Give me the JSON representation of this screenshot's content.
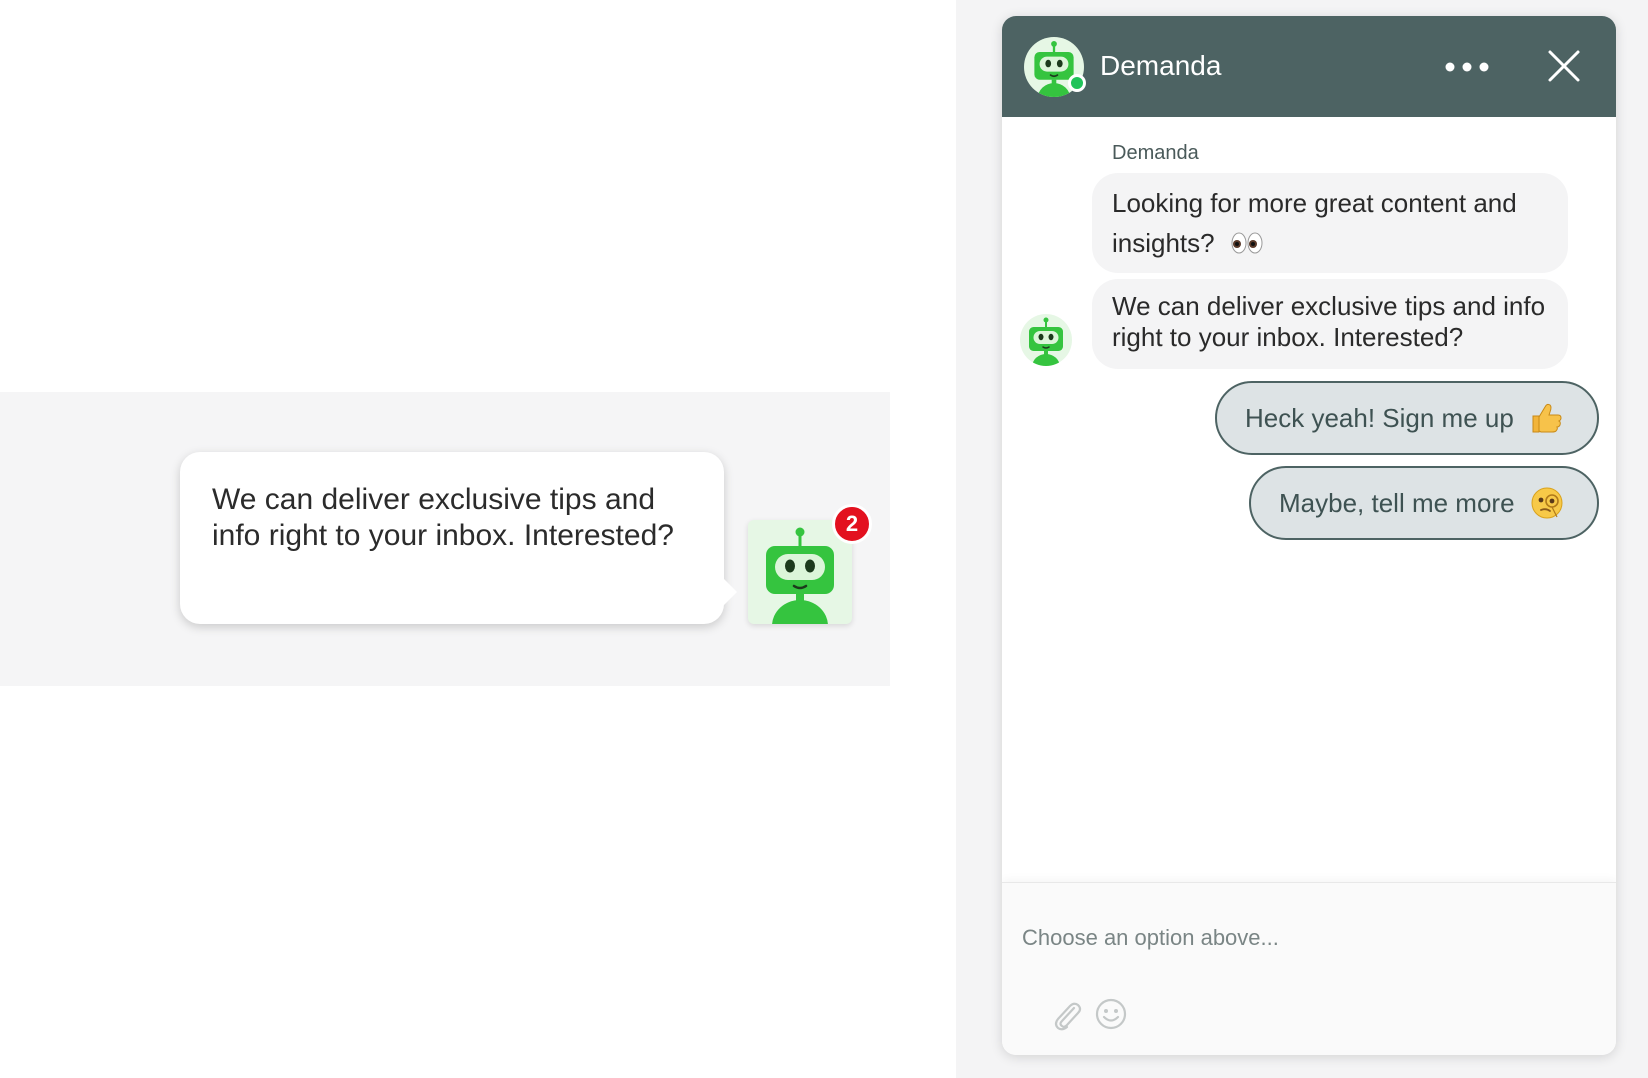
{
  "preview": {
    "bubble_text": "We can deliver exclusive tips and info right to your inbox. Interested?",
    "unread_count": "2",
    "launcher_icon": "robot-avatar-icon"
  },
  "chat": {
    "header": {
      "title": "Demanda",
      "menu_icon": "more-dots-icon",
      "close_icon": "close-icon",
      "status": "online"
    },
    "sender_name": "Demanda",
    "messages": [
      {
        "text": "Looking for more great content and insights?",
        "emoji": "eyes-emoji"
      },
      {
        "text": "We can deliver exclusive tips and info right to your inbox. Interested?"
      }
    ],
    "quick_replies": [
      {
        "label": "Heck yeah! Sign me up",
        "emoji": "thumbs-up-emoji"
      },
      {
        "label": "Maybe, tell me more",
        "emoji": "monocle-face-emoji"
      }
    ],
    "composer": {
      "placeholder": "Choose an option above...",
      "attach_icon": "paperclip-icon",
      "emoji_icon": "smiley-icon"
    }
  },
  "colors": {
    "header_bg": "#4d6363",
    "bot_green": "#35c43f",
    "badge_red": "#e3111f",
    "online_green": "#21c35a",
    "quick_reply_bg": "#dde3e5"
  }
}
